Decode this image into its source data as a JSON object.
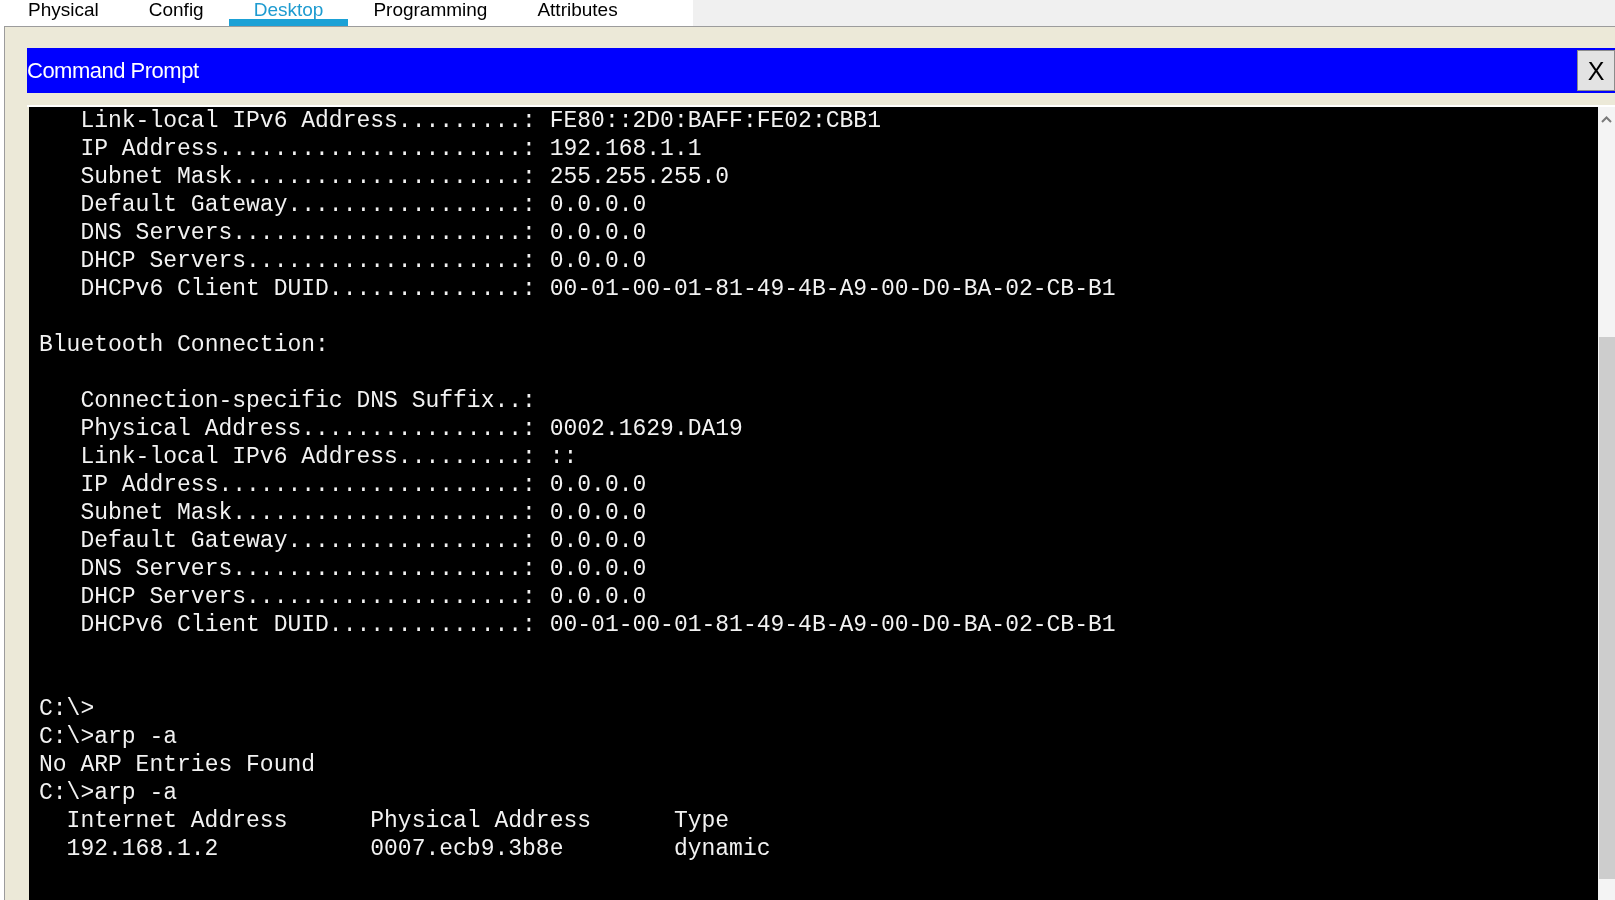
{
  "tabs": [
    {
      "label": "Physical",
      "selected": false
    },
    {
      "label": "Config",
      "selected": false
    },
    {
      "label": "Desktop",
      "selected": true
    },
    {
      "label": "Programming",
      "selected": false
    },
    {
      "label": "Attributes",
      "selected": false
    }
  ],
  "window": {
    "title": "Command Prompt",
    "close_label": "X"
  },
  "terminal": {
    "blocks": [
      {
        "kind": "fields",
        "lines": [
          "Link-local IPv6 Address.........: FE80::2D0:BAFF:FE02:CBB1",
          "IP Address......................: 192.168.1.1",
          "Subnet Mask.....................: 255.255.255.0",
          "Default Gateway.................: 0.0.0.0",
          "DNS Servers.....................: 0.0.0.0",
          "DHCP Servers....................: 0.0.0.0",
          "DHCPv6 Client DUID..............: 00-01-00-01-81-49-4B-A9-00-D0-BA-02-CB-B1"
        ]
      },
      {
        "kind": "heading",
        "lines": [
          "Bluetooth Connection:"
        ]
      },
      {
        "kind": "fields",
        "lines": [
          "Connection-specific DNS Suffix..:",
          "Physical Address................: 0002.1629.DA19",
          "Link-local IPv6 Address.........: ::",
          "IP Address......................: 0.0.0.0",
          "Subnet Mask.....................: 0.0.0.0",
          "Default Gateway.................: 0.0.0.0",
          "DNS Servers.....................: 0.0.0.0",
          "DHCP Servers....................: 0.0.0.0",
          "DHCPv6 Client DUID..............: 00-01-00-01-81-49-4B-A9-00-D0-BA-02-CB-B1"
        ]
      },
      {
        "kind": "output",
        "lines": [
          "C:\\>",
          "C:\\>arp -a",
          "No ARP Entries Found",
          "C:\\>arp -a"
        ]
      },
      {
        "kind": "table",
        "columns": [
          "Internet Address",
          "Physical Address",
          "Type"
        ],
        "rows": [
          [
            "192.168.1.2",
            "0007.ecb9.3b8e",
            "dynamic"
          ]
        ]
      }
    ]
  }
}
